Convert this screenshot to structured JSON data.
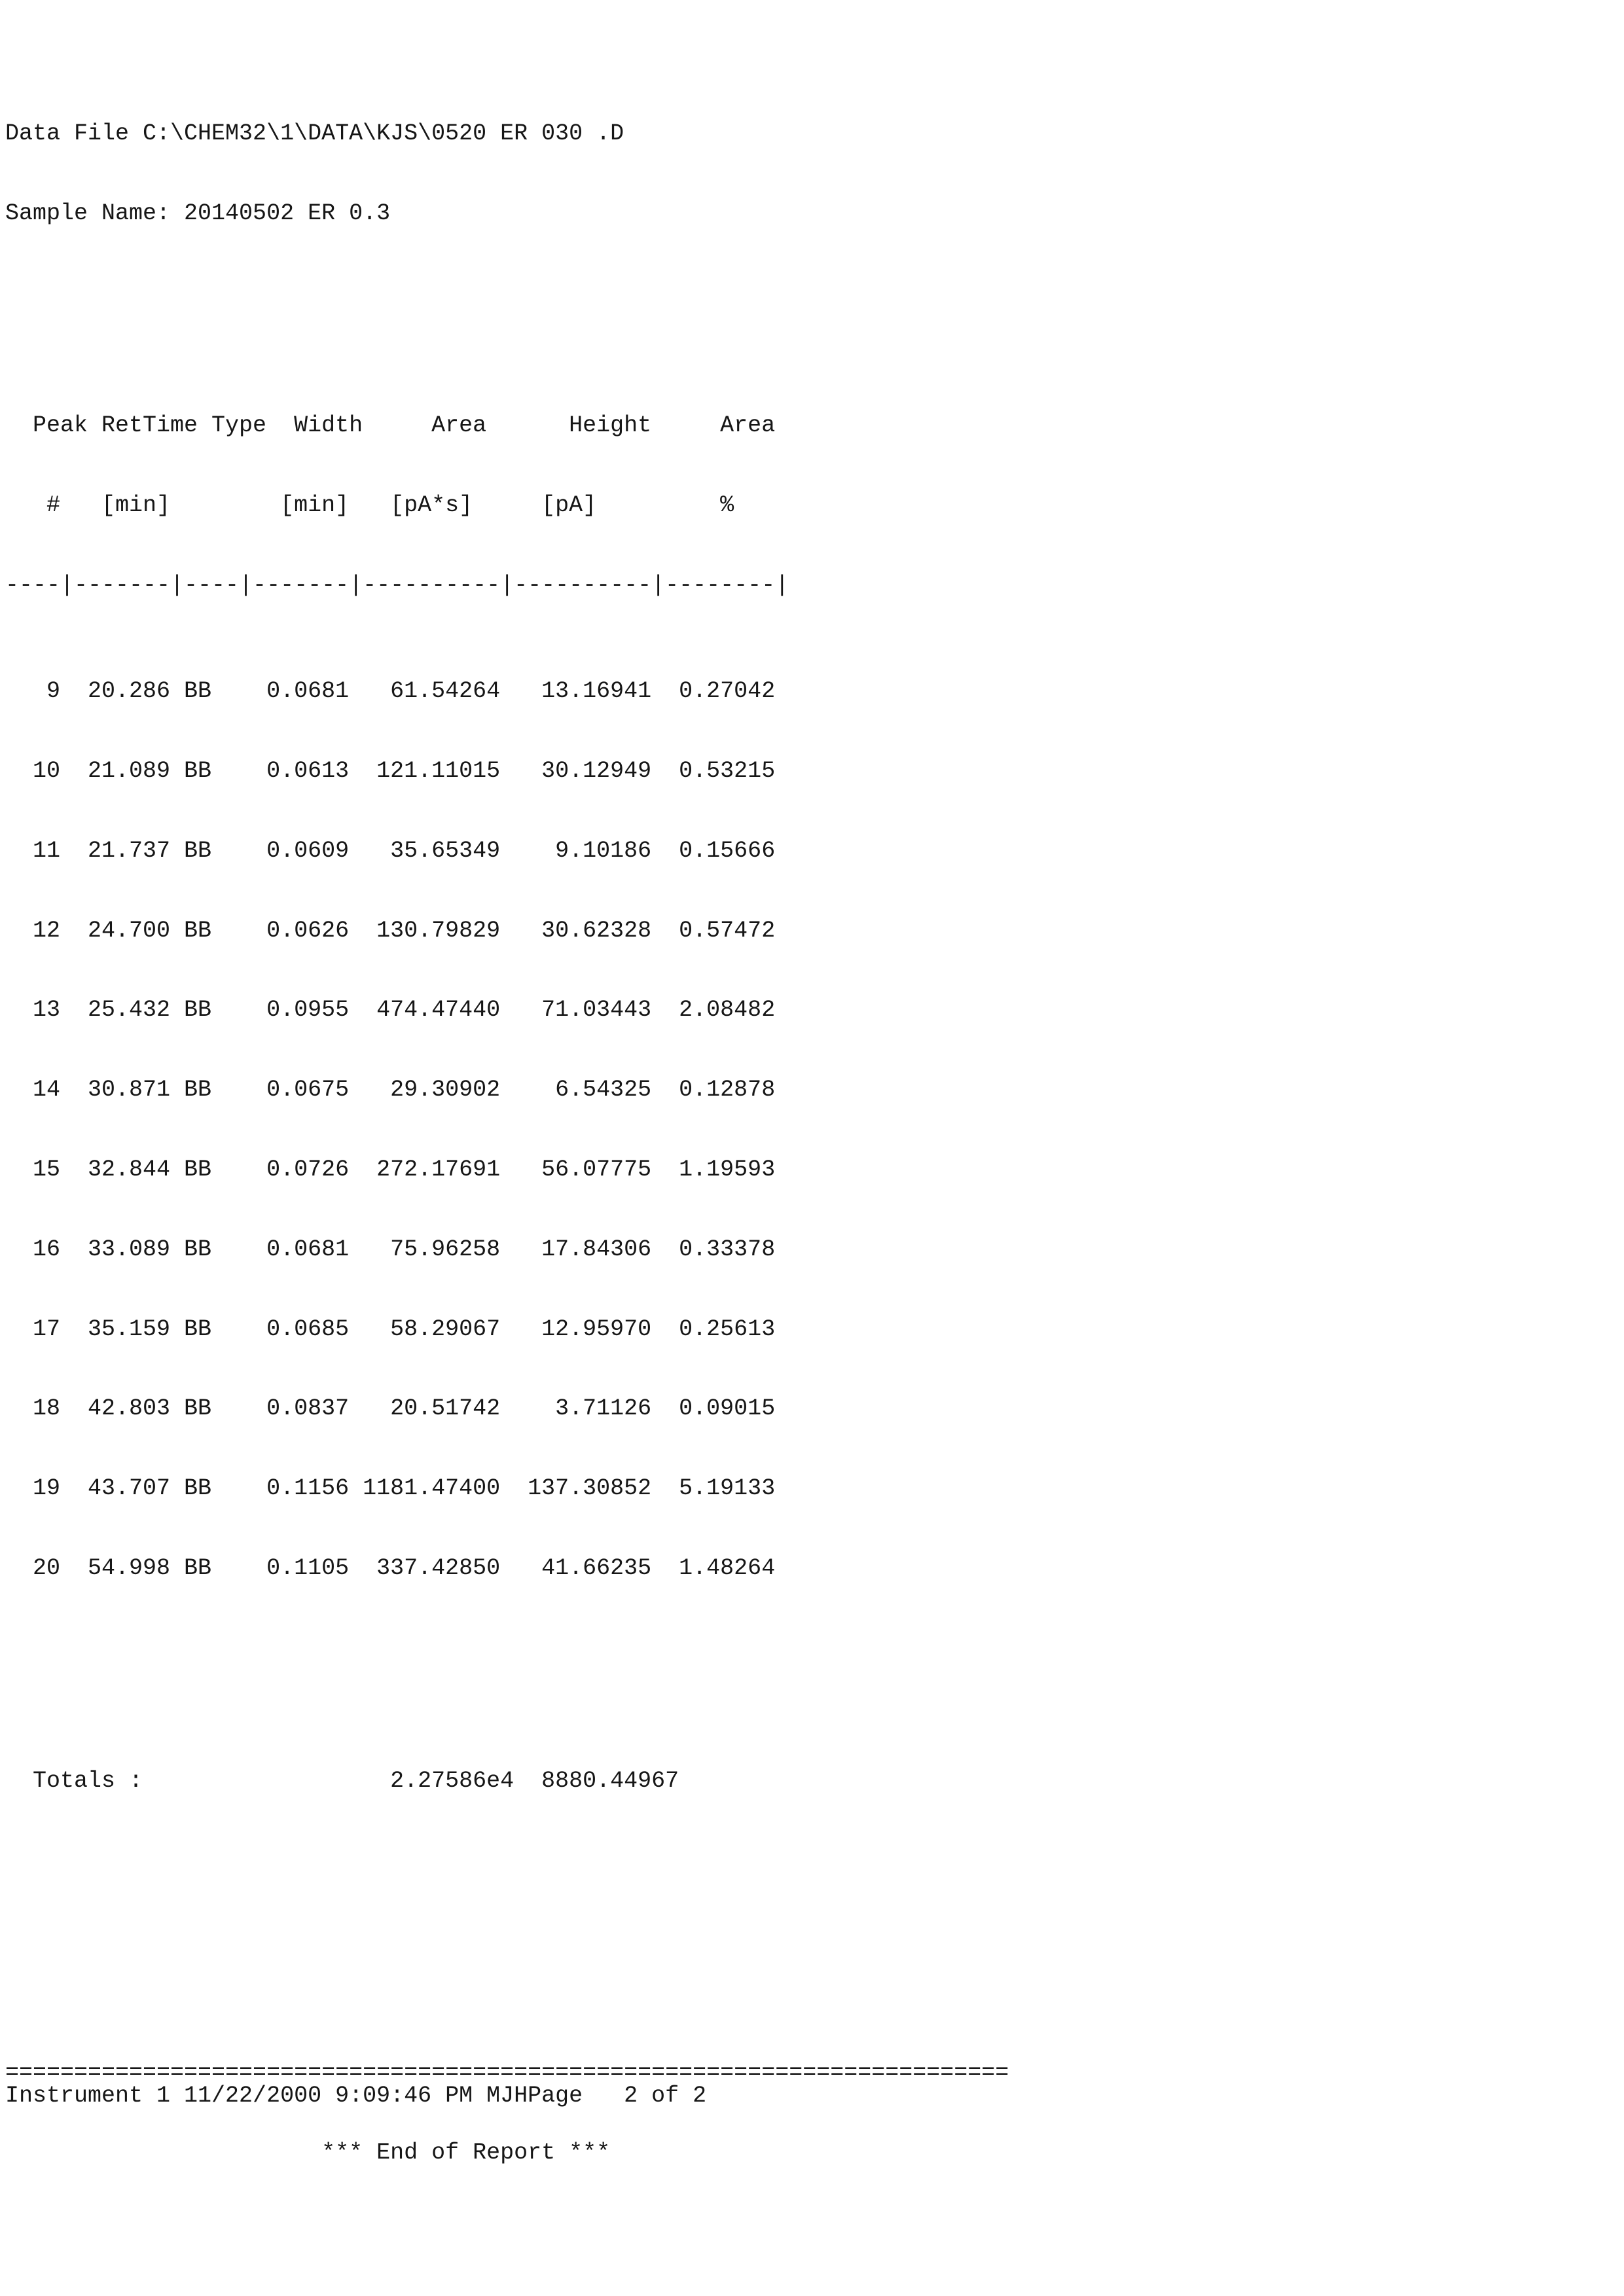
{
  "document": {
    "type": "chromatography-peak-report",
    "data_file_line": "Data File C:\\CHEM32\\1\\DATA\\KJS\\0520 ER 030 .D",
    "sample_name_line": "Sample Name: 20140502 ER 0.3",
    "data_file_label": "Data File",
    "data_file_value": "C:\\CHEM32\\1\\DATA\\KJS\\0520 ER 030 .D",
    "sample_name_label": "Sample Name:",
    "sample_name_value": "20140502 ER 0.3"
  },
  "table": {
    "header_row_1": "  Peak RetTime Type  Width     Area      Height     Area  ",
    "header_row_2": "   #   [min]        [min]   [pA*s]     [pA]         %  ",
    "separator": "----|-------|----|-------|----------|----------|--------|",
    "columns": [
      {
        "name": "Peak #",
        "unit": ""
      },
      {
        "name": "RetTime",
        "unit": "[min]"
      },
      {
        "name": "Type",
        "unit": ""
      },
      {
        "name": "Width",
        "unit": "[min]"
      },
      {
        "name": "Area",
        "unit": "[pA*s]"
      },
      {
        "name": "Height",
        "unit": "[pA]"
      },
      {
        "name": "Area",
        "unit": "%"
      }
    ],
    "rows": [
      {
        "peak": "9",
        "rettime": "20.286",
        "type": "BB",
        "width": "0.0681",
        "area": "61.54264",
        "height": "13.16941",
        "area_pct": "0.27042"
      },
      {
        "peak": "10",
        "rettime": "21.089",
        "type": "BB",
        "width": "0.0613",
        "area": "121.11015",
        "height": "30.12949",
        "area_pct": "0.53215"
      },
      {
        "peak": "11",
        "rettime": "21.737",
        "type": "BB",
        "width": "0.0609",
        "area": "35.65349",
        "height": "9.10186",
        "area_pct": "0.15666"
      },
      {
        "peak": "12",
        "rettime": "24.700",
        "type": "BB",
        "width": "0.0626",
        "area": "130.79829",
        "height": "30.62328",
        "area_pct": "0.57472"
      },
      {
        "peak": "13",
        "rettime": "25.432",
        "type": "BB",
        "width": "0.0955",
        "area": "474.47440",
        "height": "71.03443",
        "area_pct": "2.08482"
      },
      {
        "peak": "14",
        "rettime": "30.871",
        "type": "BB",
        "width": "0.0675",
        "area": "29.30902",
        "height": "6.54325",
        "area_pct": "0.12878"
      },
      {
        "peak": "15",
        "rettime": "32.844",
        "type": "BB",
        "width": "0.0726",
        "area": "272.17691",
        "height": "56.07775",
        "area_pct": "1.19593"
      },
      {
        "peak": "16",
        "rettime": "33.089",
        "type": "BB",
        "width": "0.0681",
        "area": "75.96258",
        "height": "17.84306",
        "area_pct": "0.33378"
      },
      {
        "peak": "17",
        "rettime": "35.159",
        "type": "BB",
        "width": "0.0685",
        "area": "58.29067",
        "height": "12.95970",
        "area_pct": "0.25613"
      },
      {
        "peak": "18",
        "rettime": "42.803",
        "type": "BB",
        "width": "0.0837",
        "area": "20.51742",
        "height": "3.71126",
        "area_pct": "0.09015"
      },
      {
        "peak": "19",
        "rettime": "43.707",
        "type": "BB",
        "width": "0.1156",
        "area": "1181.47400",
        "height": "137.30852",
        "area_pct": "5.19133"
      },
      {
        "peak": "20",
        "rettime": "54.998",
        "type": "BB",
        "width": "0.1105",
        "area": "337.42850",
        "height": "41.66235",
        "area_pct": "1.48264"
      }
    ],
    "row_lines": [
      "   9  20.286 BB    0.0681   61.54264   13.16941  0.27042",
      "  10  21.089 BB    0.0613  121.11015   30.12949  0.53215",
      "  11  21.737 BB    0.0609   35.65349    9.10186  0.15666",
      "  12  24.700 BB    0.0626  130.79829   30.62328  0.57472",
      "  13  25.432 BB    0.0955  474.47440   71.03443  2.08482",
      "  14  30.871 BB    0.0675   29.30902    6.54325  0.12878",
      "  15  32.844 BB    0.0726  272.17691   56.07775  1.19593",
      "  16  33.089 BB    0.0681   75.96258   17.84306  0.33378",
      "  17  35.159 BB    0.0685   58.29067   12.95970  0.25613",
      "  18  42.803 BB    0.0837   20.51742    3.71126  0.09015",
      "  19  43.707 BB    0.1156 1181.47400  137.30852  5.19133",
      "  20  54.998 BB    0.1105  337.42850   41.66235  1.48264"
    ],
    "totals": {
      "label": "Totals :",
      "area": "2.27586e4",
      "height": "8880.44967",
      "line": "  Totals :                  2.27586e4  8880.44967"
    }
  },
  "report_end": {
    "rule": "=========================================================================",
    "text": "*** End of Report ***",
    "text_line": "                       *** End of Report ***"
  },
  "footer": {
    "instrument": "Instrument 1",
    "date": "11/22/2000",
    "time": "9:09:46 PM",
    "operator": "MJH",
    "left_line": "Instrument 1 11/22/2000 9:09:46 PM MJH",
    "page_label": "Page",
    "page_value": "2 of 2",
    "right_line": "Page   2 of 2"
  }
}
